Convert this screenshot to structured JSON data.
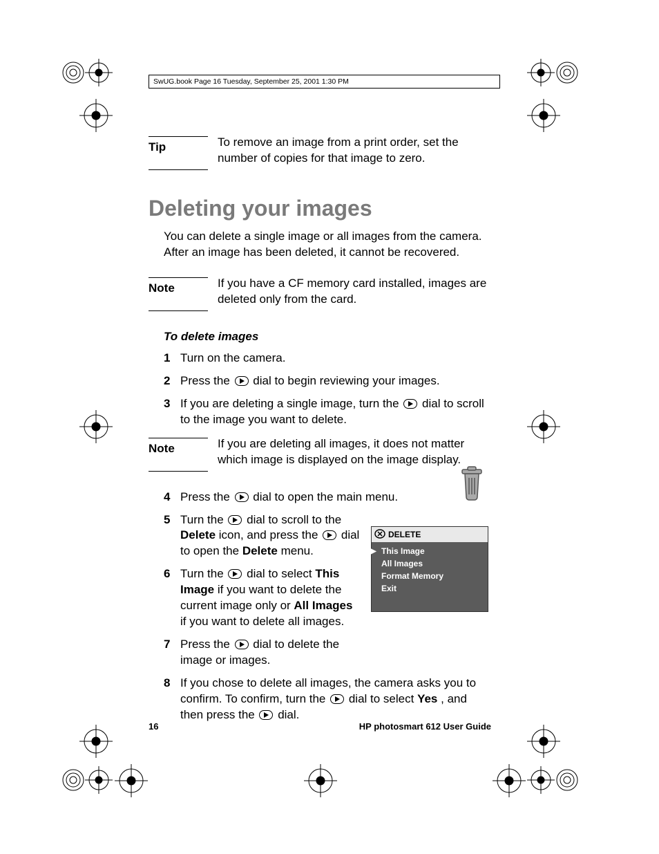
{
  "header": "SwUG.book  Page 16  Tuesday, September 25, 2001  1:30 PM",
  "tip": {
    "label": "Tip",
    "body": "To remove an image from a print order, set the number of copies for that image to zero."
  },
  "h1": "Deleting your images",
  "intro": "You can delete a single image or all images from the camera. After an image has been deleted, it cannot be recovered.",
  "note1": {
    "label": "Note",
    "body": "If you have a CF memory card installed, images are deleted only from the card."
  },
  "subhead": "To delete images",
  "steps": {
    "s1": "Turn on the camera.",
    "s2a": "Press the ",
    "s2b": " dial to begin reviewing your images.",
    "s3a": "If you are deleting a single image, turn the ",
    "s3b": " dial to scroll to the image you want to delete.",
    "s4a": "Press the ",
    "s4b": " dial to open the main menu.",
    "s5a": "Turn the ",
    "s5b": " dial to scroll to the ",
    "s5bold1": "Delete",
    "s5c": " icon, and press the ",
    "s5d": " dial to open the ",
    "s5bold2": "Delete",
    "s5e": " menu.",
    "s6a": "Turn the ",
    "s6b": " dial to select ",
    "s6bold1": "This Image",
    "s6c": " if you want to delete the current image only or ",
    "s6bold2": "All Images",
    "s6d": " if you want to delete all images.",
    "s7a": "Press the ",
    "s7b": " dial to delete the image or images.",
    "s8a": "If you chose to delete all images, the camera asks you to confirm. To confirm, turn the ",
    "s8b": " dial to select ",
    "s8bold1": "Yes",
    "s8c": ", and then press the ",
    "s8d": " dial."
  },
  "note2": {
    "label": "Note",
    "body": "If you are deleting all images, it does not matter which image is displayed on the image display."
  },
  "lcd": {
    "title": "DELETE",
    "items": [
      "This Image",
      "All Images",
      "Format Memory",
      "Exit"
    ]
  },
  "footer": {
    "page": "16",
    "title": "HP photosmart 612 User Guide"
  }
}
